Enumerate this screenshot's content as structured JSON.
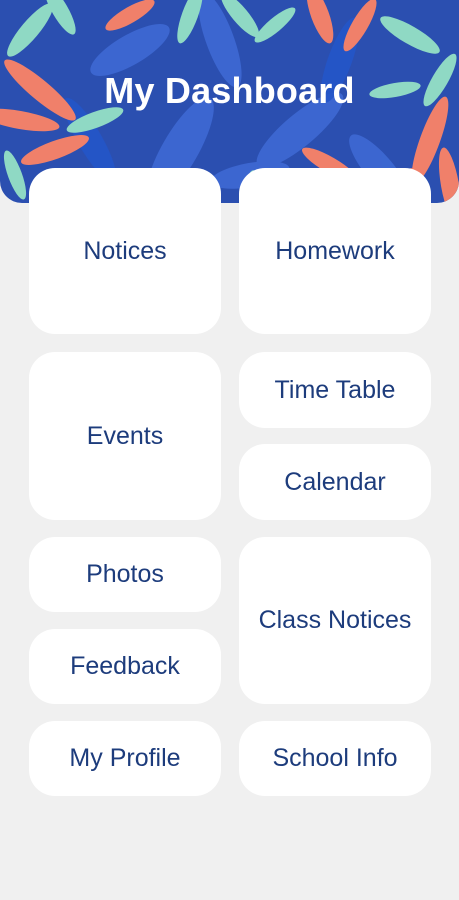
{
  "header": {
    "title": "My Dashboard"
  },
  "colors": {
    "header_background": "#2b4fb0",
    "leaf_coral": "#f0806a",
    "leaf_mint": "#8fd9c4",
    "leaf_blue": "#3f6bd6",
    "tile_text": "#1d3c7c",
    "page_background": "#f0f0f0"
  },
  "tiles": {
    "notices": "Notices",
    "homework": "Homework",
    "events": "Events",
    "time_table": "Time Table",
    "calendar": "Calendar",
    "photos": "Photos",
    "class_notices": "Class Notices",
    "feedback": "Feedback",
    "my_profile": "My Profile",
    "school_info": "School Info"
  }
}
